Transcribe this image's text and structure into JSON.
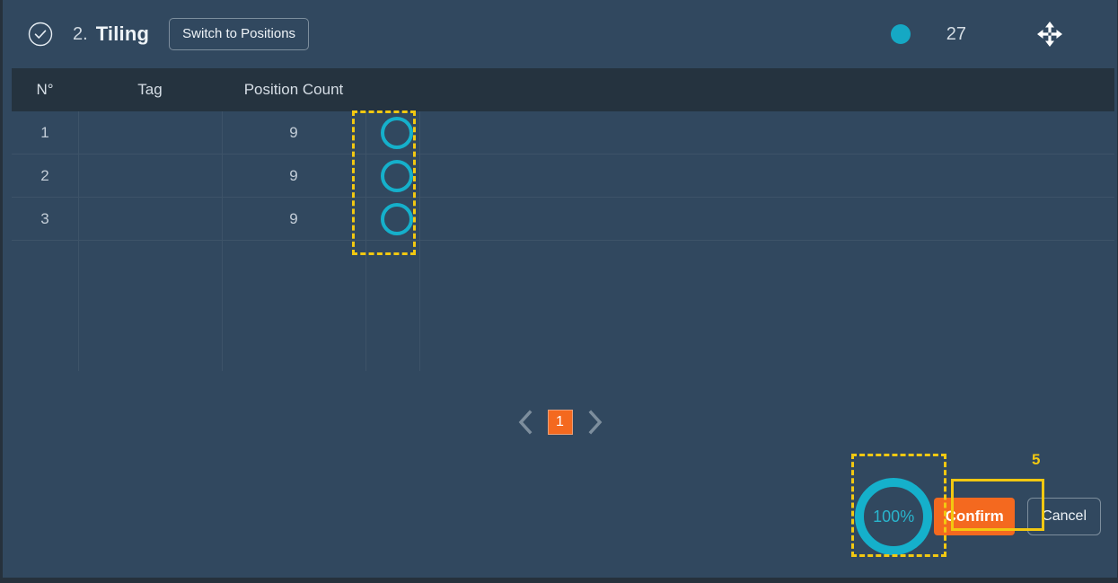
{
  "header": {
    "status_icon": "check-circle-icon",
    "step_number": "2.",
    "title": "Tiling",
    "switch_button": "Switch to Positions",
    "status_dot_icon": "filled-circle-icon",
    "status_dot_color": "#15a8c4",
    "count": "27",
    "move_icon": "move-arrows-icon"
  },
  "table": {
    "columns": [
      "N°",
      "Tag",
      "Position Count",
      ""
    ],
    "rows": [
      {
        "no": "1",
        "tag": "",
        "position_count": "9",
        "mark_icon": "circle-outline-icon"
      },
      {
        "no": "2",
        "tag": "",
        "position_count": "9",
        "mark_icon": "circle-outline-icon"
      },
      {
        "no": "3",
        "tag": "",
        "position_count": "9",
        "mark_icon": "circle-outline-icon"
      }
    ]
  },
  "pagination": {
    "prev_icon": "chevron-left-icon",
    "current_page": "1",
    "next_icon": "chevron-right-icon"
  },
  "footer": {
    "progress_percent": "100%",
    "confirm_label": "Confirm",
    "cancel_label": "Cancel",
    "annotation_number": "5"
  },
  "colors": {
    "background": "#31485f",
    "table_header": "#25333f",
    "accent_orange": "#f4691f",
    "accent_cyan": "#15a8c4",
    "highlight_yellow": "#f2c811",
    "border": "#3d5368"
  }
}
